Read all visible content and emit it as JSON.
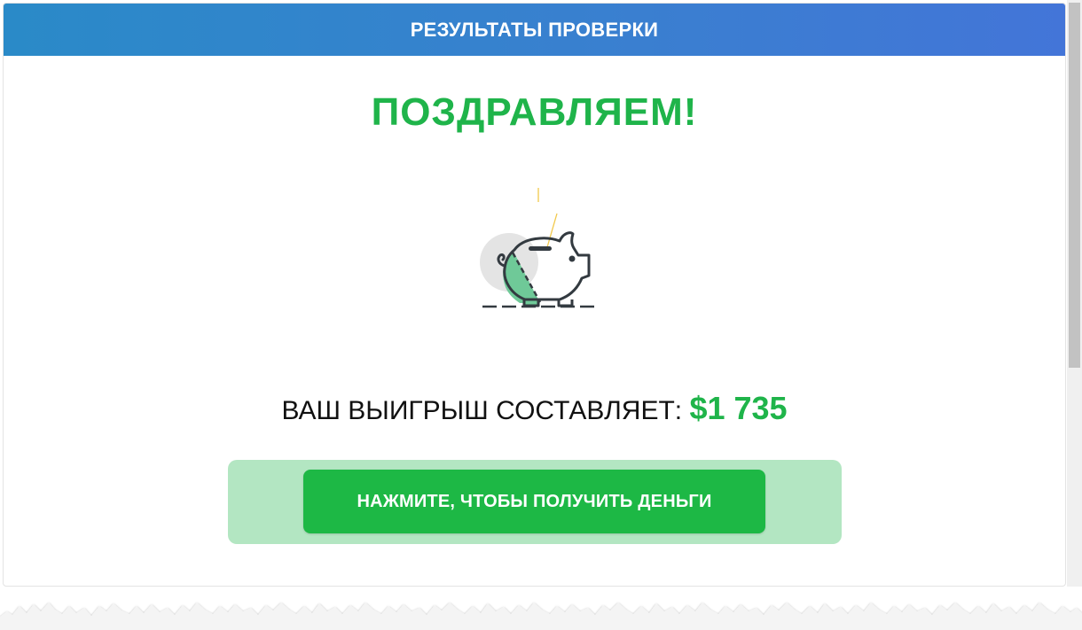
{
  "header": {
    "title": "РЕЗУЛЬТАТЫ ПРОВЕРКИ"
  },
  "main": {
    "headline": "ПОЗДРАВЛЯЕМ!",
    "illustration": "piggy-bank-icon",
    "winnings_label": "ВАШ ВЫИГРЫШ СОСТАВЛЯЕТ:",
    "winnings_amount": "$1 735",
    "cta_label": "НАЖМИТЕ, ЧТОБЫ ПОЛУЧИТЬ ДЕНЬГИ"
  },
  "colors": {
    "header_gradient_start": "#2a8ac8",
    "header_gradient_end": "#4375d8",
    "accent_green": "#1fb44a",
    "cta_background": "#1db845",
    "cta_halo": "#b3e6c2"
  }
}
